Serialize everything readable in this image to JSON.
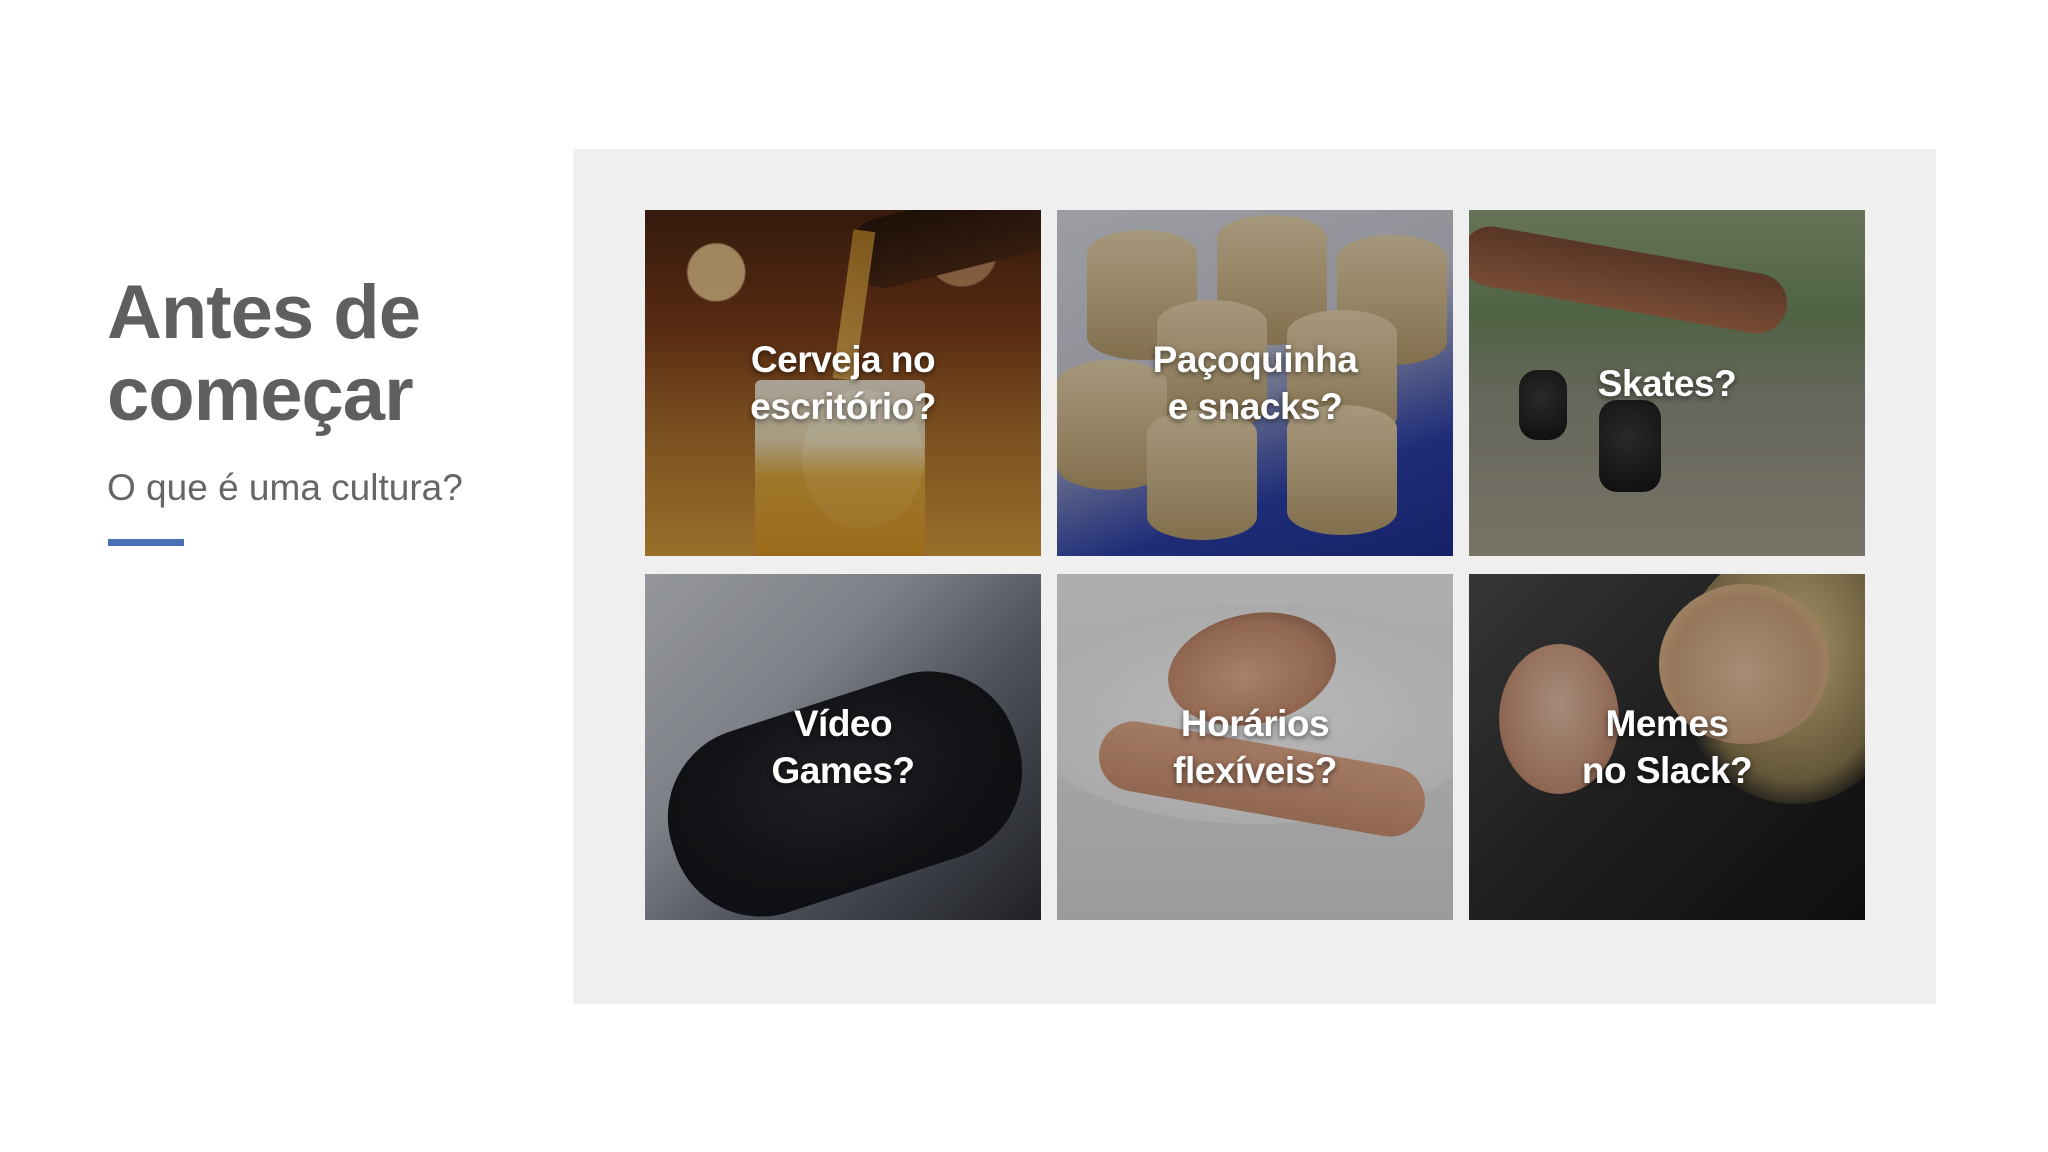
{
  "slide": {
    "title_lines": [
      "Antes de",
      "começar"
    ],
    "subtitle": "O que é uma cultura?",
    "accent_color": "#4a6fb5",
    "panel_color": "#efeff0"
  },
  "tiles": [
    {
      "lines": [
        "Cerveja no",
        "escritório?"
      ],
      "scene": "beer-pouring-photo"
    },
    {
      "lines": [
        "Paçoquinha",
        "e snacks?"
      ],
      "scene": "pacoca-snacks-photo"
    },
    {
      "lines": [
        "Skates?"
      ],
      "scene": "skateboard-photo"
    },
    {
      "lines": [
        "Vídeo",
        "Games?"
      ],
      "scene": "game-controller-photo"
    },
    {
      "lines": [
        "Horários",
        "flexíveis?"
      ],
      "scene": "sleeping-woman-photo"
    },
    {
      "lines": [
        "Memes",
        "no Slack?"
      ],
      "scene": "meme-photo"
    }
  ]
}
